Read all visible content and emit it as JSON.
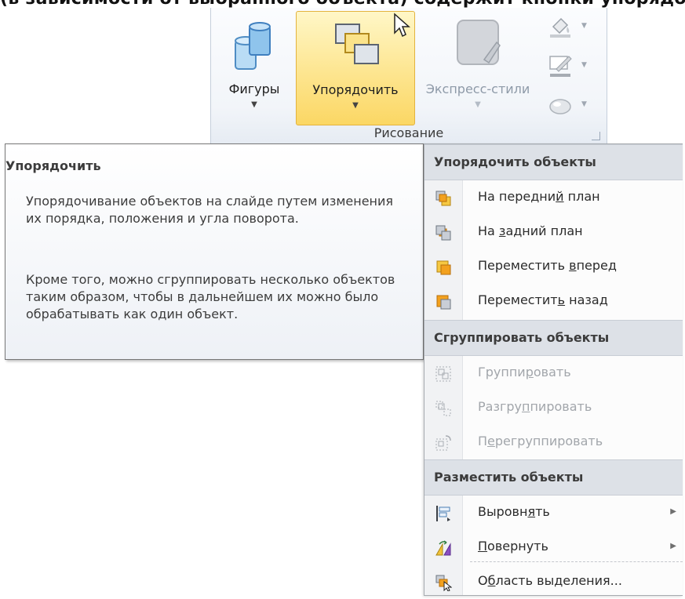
{
  "heading_cropped": "(в зависимости от выбранного объекта) содержит кнопки упорядочивания",
  "ribbon": {
    "shapes_label": "Фигуры",
    "arrange_label": "Упорядочить",
    "quick_styles_label": "Экспресс-стили",
    "group_label": "Рисование"
  },
  "tooltip": {
    "title": "Упорядочить",
    "paragraph1": "Упорядочивание объектов на слайде путем изменения их порядка, положения и угла поворота.",
    "paragraph2": "Кроме того, можно сгруппировать несколько объектов таким образом, чтобы в дальнейшем их можно было обрабатывать как один объект."
  },
  "menu": {
    "section_order": "Упорядочить объекты",
    "bring_front": {
      "pre": "На передни",
      "key": "й",
      "post": " план"
    },
    "send_back": {
      "pre": "На ",
      "key": "з",
      "post": "адний план"
    },
    "bring_forward": {
      "pre": "Переместить ",
      "key": "в",
      "post": "перед"
    },
    "send_backward": {
      "pre": "Переместит",
      "key": "ь",
      "post": " назад"
    },
    "section_group": "Сгруппировать объекты",
    "group": {
      "pre": "Группи",
      "key": "р",
      "post": "овать"
    },
    "ungroup": {
      "pre": "Разгру",
      "key": "п",
      "post": "пировать"
    },
    "regroup": {
      "pre": "П",
      "key": "е",
      "post": "регруппировать"
    },
    "section_position": "Разместить объекты",
    "align": {
      "pre": "Выровн",
      "key": "я",
      "post": "ть"
    },
    "rotate": {
      "pre": "",
      "key": "П",
      "post": "овернуть"
    },
    "selection_pane": {
      "pre": "О",
      "key": "б",
      "post": "ласть выделения..."
    }
  },
  "colors": {
    "highlight_top": "#fff7c7",
    "highlight_bottom": "#fbd764",
    "menu_header": "#dde1e7",
    "disabled_text": "#a2a6ab"
  }
}
